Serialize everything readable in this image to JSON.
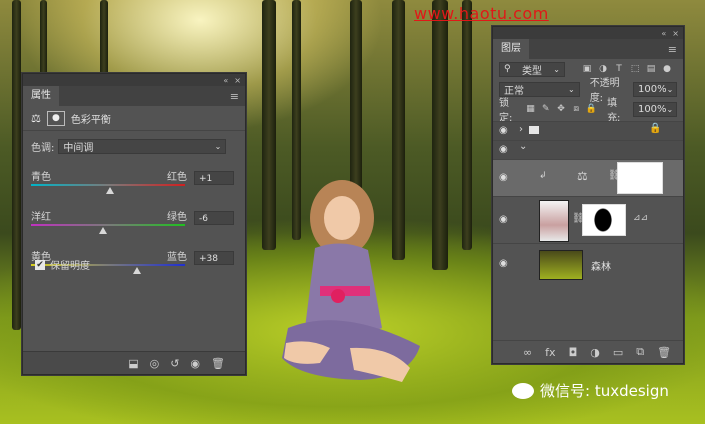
{
  "watermark": "www.haotu.com",
  "weixin": "微信号: tuxdesign",
  "properties": {
    "tab": "属性",
    "collapse": "«",
    "close": "×",
    "menu": "≡",
    "head_title": "色彩平衡",
    "tone_label": "色调:",
    "tone_value": "中间调",
    "sliders": [
      {
        "left": "青色",
        "right": "红色",
        "value": "+1",
        "pos": 0.51,
        "c1": "#00b4c8",
        "c2": "#d02020"
      },
      {
        "left": "洋红",
        "right": "绿色",
        "value": "-6",
        "pos": 0.47,
        "c1": "#c030c0",
        "c2": "#20c020"
      },
      {
        "left": "黄色",
        "right": "蓝色",
        "value": "+38",
        "pos": 0.69,
        "c1": "#d8d020",
        "c2": "#2030d0"
      }
    ],
    "preserve": "保留明度",
    "check": "✔"
  },
  "layers": {
    "tab": "图层",
    "collapse": "«",
    "close": "×",
    "menu": "≡",
    "kind": "类型",
    "blend": "正常",
    "opacity_label": "不透明度:",
    "opacity": "100%",
    "lock_label": "锁定:",
    "fill_label": "填充:",
    "fill": "100%",
    "bg_layer_name": "森林",
    "bottom_icons": [
      "∞",
      "fx",
      "◘",
      "◑",
      "▭",
      "⧉",
      "🗑"
    ]
  },
  "colors": {
    "panel": "#535353",
    "accent": "#e01818"
  }
}
